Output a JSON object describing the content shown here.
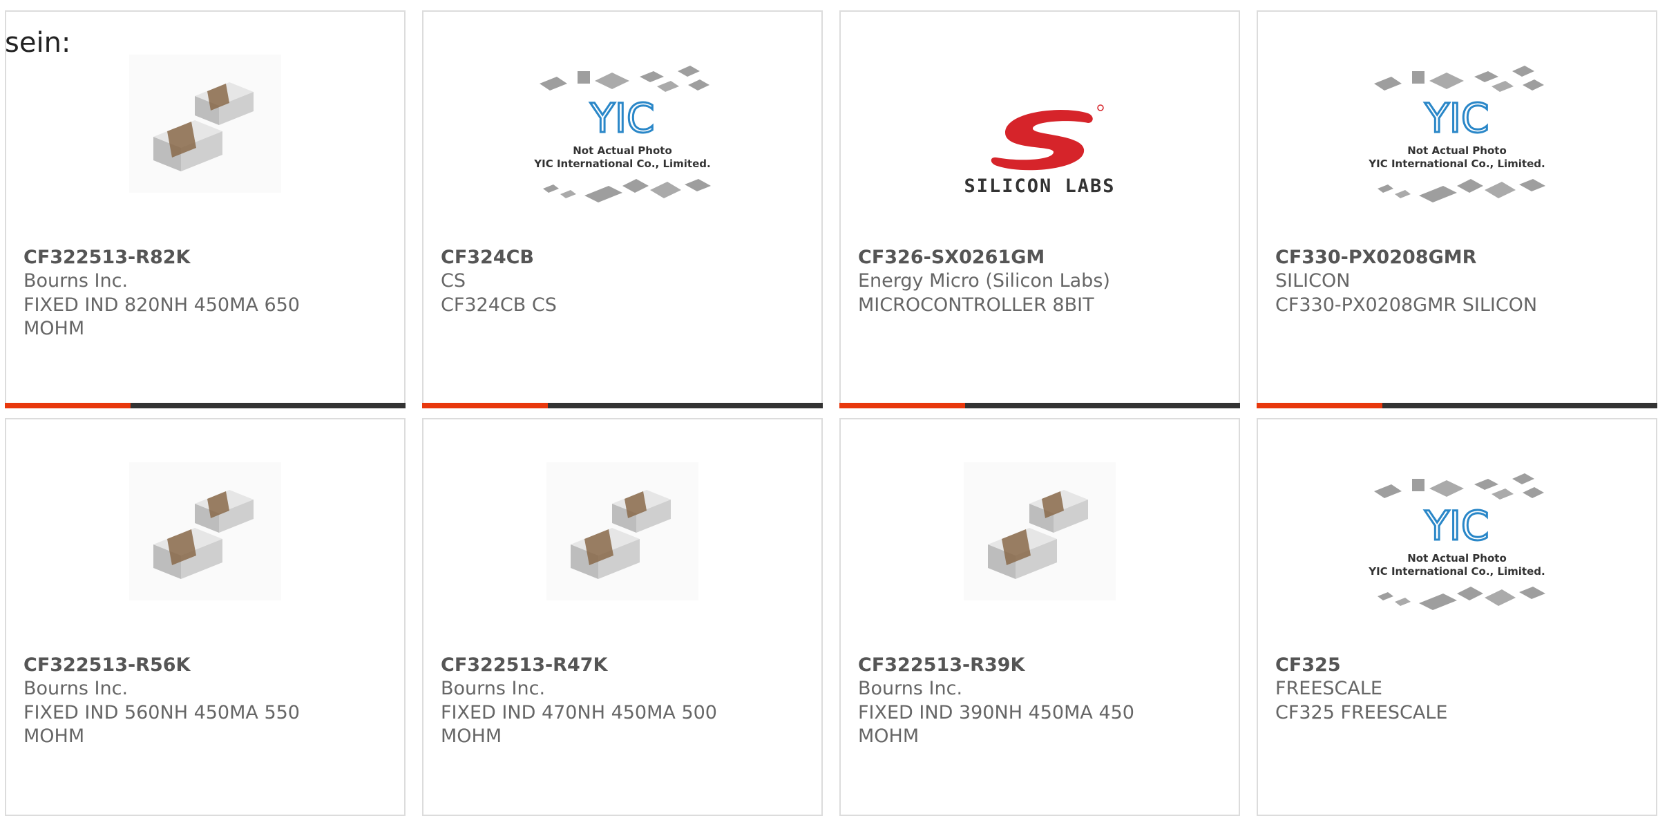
{
  "heading": "sein:",
  "products": [
    {
      "part_number": "CF322513-R82K",
      "manufacturer": "Bourns Inc.",
      "description": "FIXED IND 820NH 450MA 650 MOHM",
      "image": "chip-inductor-photo"
    },
    {
      "part_number": "CF324CB",
      "manufacturer": "CS",
      "description": "CF324CB CS",
      "image": "placeholder-yic",
      "placeholder_line1": "Not Actual Photo",
      "placeholder_line2": "YIC International Co., Limited."
    },
    {
      "part_number": "CF326-SX0261GM",
      "manufacturer": "Energy Micro (Silicon Labs)",
      "description": "MICROCONTROLLER 8BIT",
      "image": "silicon-labs-logo",
      "logo_text": "SILICON LABS"
    },
    {
      "part_number": "CF330-PX0208GMR",
      "manufacturer": "SILICON",
      "description": "CF330-PX0208GMR SILICON",
      "image": "placeholder-yic",
      "placeholder_line1": "Not Actual Photo",
      "placeholder_line2": "YIC International Co., Limited."
    },
    {
      "part_number": "CF322513-R56K",
      "manufacturer": "Bourns Inc.",
      "description": "FIXED IND 560NH 450MA 550 MOHM",
      "image": "chip-inductor-photo"
    },
    {
      "part_number": "CF322513-R47K",
      "manufacturer": "Bourns Inc.",
      "description": "FIXED IND 470NH 450MA 500 MOHM",
      "image": "chip-inductor-photo"
    },
    {
      "part_number": "CF322513-R39K",
      "manufacturer": "Bourns Inc.",
      "description": "FIXED IND 390NH 450MA 450 MOHM",
      "image": "chip-inductor-photo"
    },
    {
      "part_number": "CF325",
      "manufacturer": "FREESCALE",
      "description": "CF325 FREESCALE",
      "image": "placeholder-yic",
      "placeholder_line1": "Not Actual Photo",
      "placeholder_line2": "YIC International Co., Limited."
    }
  ],
  "colors": {
    "accent": "#e8380d",
    "bar": "#333333",
    "border": "#dcdcdc",
    "logo_red": "#d6242a"
  }
}
